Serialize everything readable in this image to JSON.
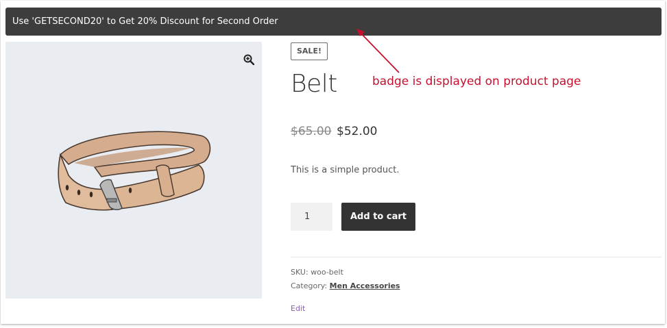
{
  "notice": {
    "text": "Use 'GETSECOND20' to Get 20% Discount for Second Order"
  },
  "gallery": {
    "zoom_icon": "zoom-in-icon",
    "image": "belt-product-image"
  },
  "product": {
    "badge": "SALE!",
    "title": "Belt",
    "price_old": "$65.00",
    "price_new": "$52.00",
    "description": "This is a simple product.",
    "quantity": "1",
    "add_to_cart_label": "Add to cart",
    "sku_label": "SKU:",
    "sku_value": "woo-belt",
    "category_label": "Category:",
    "category_value": "Men Accessories",
    "edit_label": "Edit"
  },
  "annotation": {
    "text": "badge is displayed on product page",
    "color": "#c8102e"
  },
  "colors": {
    "notice_bg": "#3d3d3d",
    "button_bg": "#333333",
    "gallery_bg": "#e9edf2",
    "link_purple": "#8a5ea8"
  }
}
